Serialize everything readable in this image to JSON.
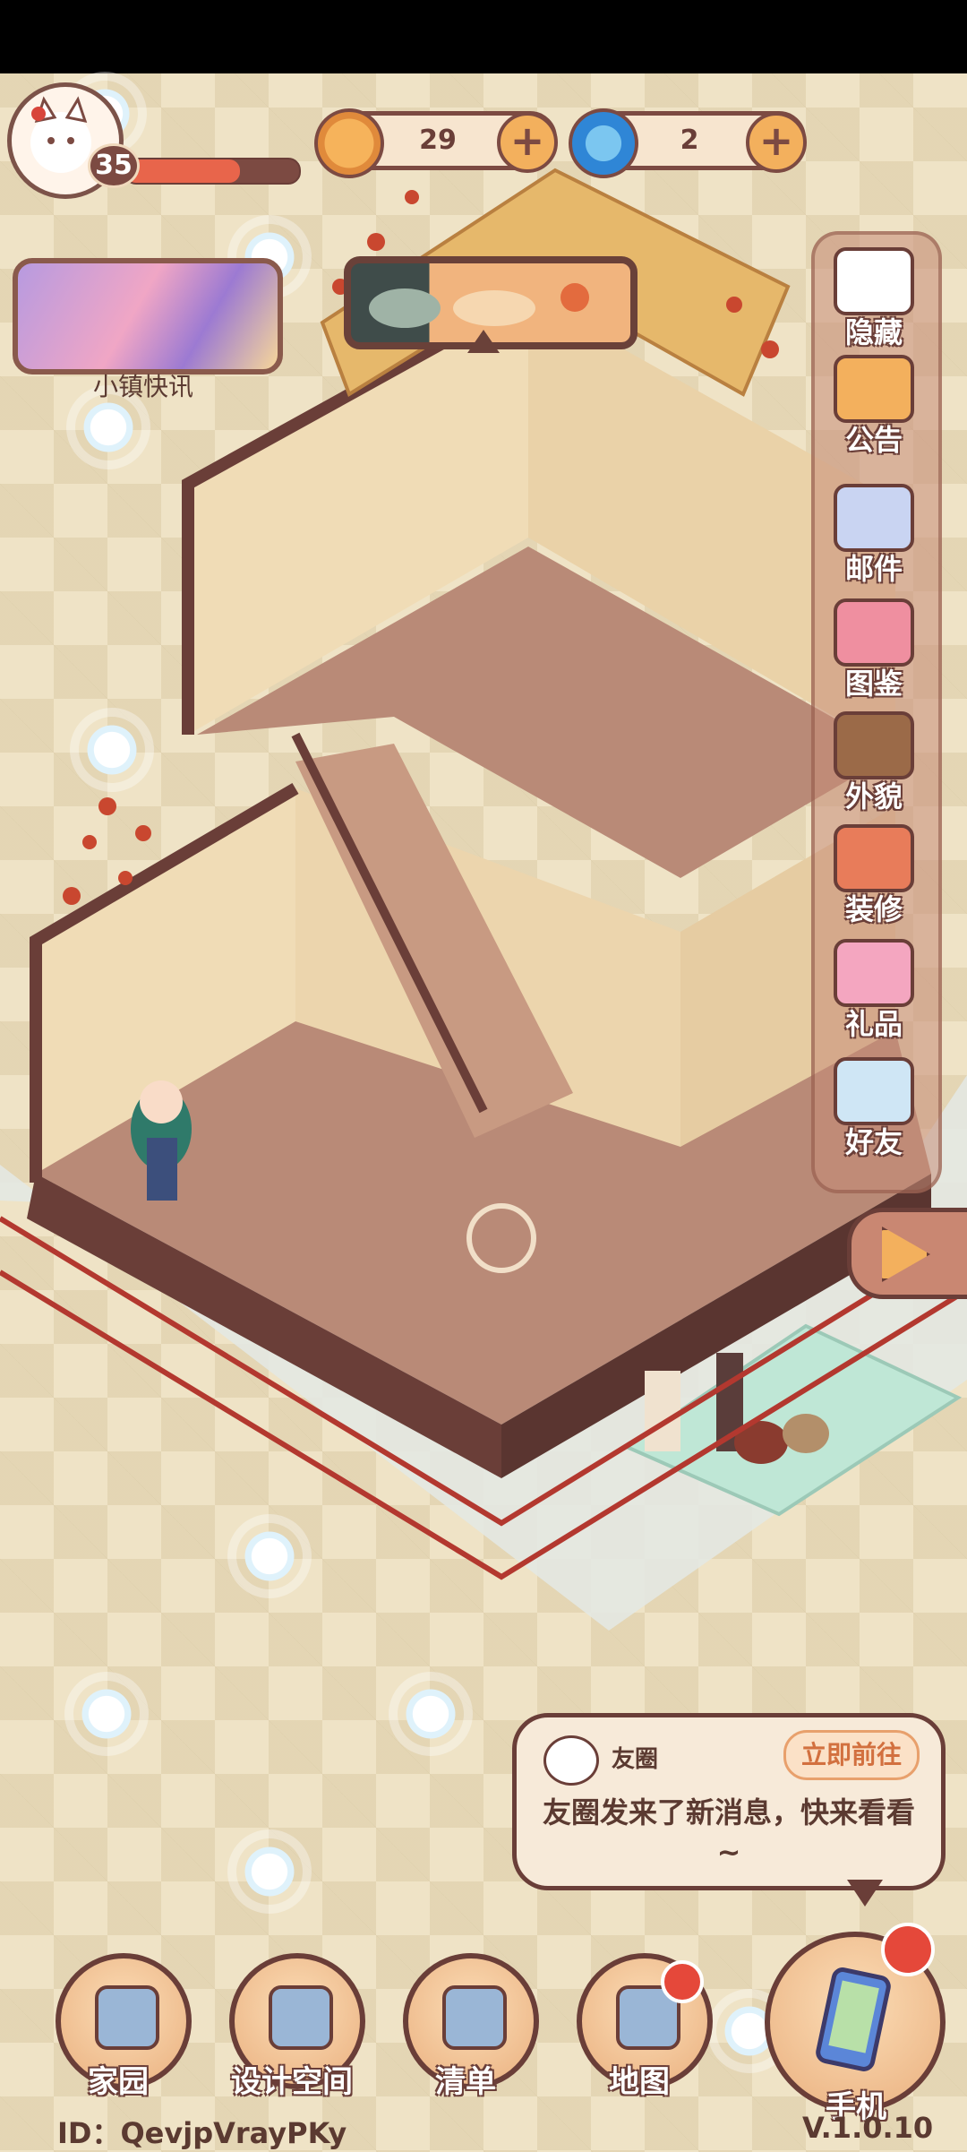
{
  "hud": {
    "level": "35",
    "xp_progress": 0.66,
    "currency_coins": "29",
    "currency_swirl": "2"
  },
  "news": {
    "label": "小镇快讯"
  },
  "side_menu": [
    {
      "label": "隐藏",
      "icon": "hide-icon"
    },
    {
      "label": "公告",
      "icon": "megaphone-icon"
    },
    {
      "label": "邮件",
      "icon": "mail-icon"
    },
    {
      "label": "图鉴",
      "icon": "book-icon"
    },
    {
      "label": "外貌",
      "icon": "character-face-icon"
    },
    {
      "label": "装修",
      "icon": "house-wrench-icon"
    },
    {
      "label": "礼品",
      "icon": "gift-icon"
    },
    {
      "label": "好友",
      "icon": "contacts-icon"
    }
  ],
  "notification": {
    "title": "友圈",
    "action": "立即前往",
    "message": "友圈发来了新消息，快来看看~"
  },
  "bottom_nav": [
    {
      "label": "家园",
      "icon": "home-icon",
      "badge": false
    },
    {
      "label": "设计空间",
      "icon": "design-icon",
      "badge": false
    },
    {
      "label": "清单",
      "icon": "list-icon",
      "badge": false
    },
    {
      "label": "地图",
      "icon": "map-pin-icon",
      "badge": true
    }
  ],
  "phone": {
    "label": "手机",
    "badge": true
  },
  "footer": {
    "id": "ID：QevjpVrayPKy",
    "version": "V.1.0.10"
  },
  "colors": {
    "accent": "#f3b05d",
    "outline": "#6a3e38",
    "badge": "#e5483a",
    "floor": "#b88673",
    "wall": "#efdcb8"
  }
}
